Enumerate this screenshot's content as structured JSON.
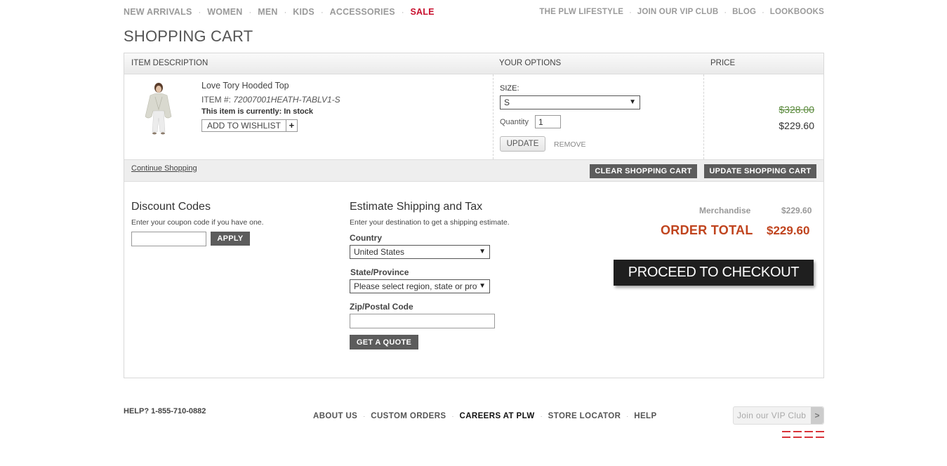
{
  "top_nav": {
    "left": [
      {
        "label": "NEW ARRIVALS",
        "sale": false
      },
      {
        "label": "WOMEN",
        "sale": false
      },
      {
        "label": "MEN",
        "sale": false
      },
      {
        "label": "KIDS",
        "sale": false
      },
      {
        "label": "ACCESSORIES",
        "sale": false
      },
      {
        "label": "SALE",
        "sale": true
      }
    ],
    "right": [
      "THE PLW LIFESTYLE",
      "JOIN OUR VIP CLUB",
      "BLOG",
      "LOOKBOOKS"
    ],
    "separator": "·"
  },
  "page_title": "SHOPPING CART",
  "cart": {
    "headers": {
      "description": "ITEM DESCRIPTION",
      "options": "YOUR OPTIONS",
      "price": "PRICE"
    },
    "item": {
      "name": "Love Tory Hooded Top",
      "sku_label": "ITEM #:",
      "sku": "72007001HEATH-TABLV1-S",
      "stock_label": "This item is currently:",
      "stock_value": "In stock",
      "wishlist_label": "ADD TO WISHLIST",
      "wishlist_plus": "+",
      "size_label": "SIZE:",
      "size_value": "S",
      "quantity_label": "Quantity",
      "quantity_value": "1",
      "update_label": "UPDATE",
      "remove_label": "REMOVE",
      "original_price": "$328.00",
      "sale_price": "$229.60"
    },
    "continue_label": "Continue Shopping",
    "clear_label": "CLEAR SHOPPING CART",
    "update_cart_label": "UPDATE SHOPPING CART"
  },
  "discount": {
    "title": "Discount Codes",
    "subtitle": "Enter your coupon code if you have one.",
    "input_value": "",
    "apply_label": "APPLY"
  },
  "shipping": {
    "title": "Estimate Shipping and Tax",
    "subtitle": "Enter your destination to get a shipping estimate.",
    "country_label": "Country",
    "country_value": "United States",
    "state_label": "State/Province",
    "state_value": "Please select region, state or province",
    "zip_label": "Zip/Postal Code",
    "zip_value": "",
    "quote_label": "GET A QUOTE"
  },
  "summary": {
    "merchandise_label": "Merchandise",
    "merchandise_value": "$229.60",
    "total_label": "ORDER TOTAL",
    "total_value": "$229.60",
    "checkout_label": "PROCEED TO CHECKOUT"
  },
  "footer": {
    "help": "HELP? 1-855-710-0882",
    "links": [
      {
        "label": "ABOUT US",
        "dark": false
      },
      {
        "label": "CUSTOM ORDERS",
        "dark": false
      },
      {
        "label": "CAREERS AT PLW",
        "dark": true
      },
      {
        "label": "STORE LOCATOR",
        "dark": false
      },
      {
        "label": "HELP",
        "dark": false
      }
    ],
    "vip_label": "Join our VIP Club",
    "vip_arrow": ">"
  },
  "colors": {
    "sale_red": "#c8102e",
    "total_orange": "#c0441e",
    "old_price_green": "#5a8a3c",
    "dark_button": "#5c5c5c",
    "checkout_button": "#1f1f1f"
  }
}
